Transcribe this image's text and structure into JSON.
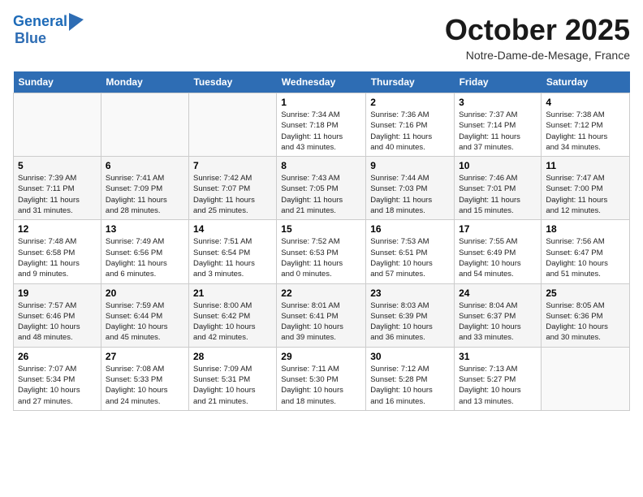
{
  "header": {
    "logo_line1": "General",
    "logo_line2": "Blue",
    "month": "October 2025",
    "location": "Notre-Dame-de-Mesage, France"
  },
  "days_of_week": [
    "Sunday",
    "Monday",
    "Tuesday",
    "Wednesday",
    "Thursday",
    "Friday",
    "Saturday"
  ],
  "weeks": [
    [
      {
        "day": "",
        "info": ""
      },
      {
        "day": "",
        "info": ""
      },
      {
        "day": "",
        "info": ""
      },
      {
        "day": "1",
        "info": "Sunrise: 7:34 AM\nSunset: 7:18 PM\nDaylight: 11 hours\nand 43 minutes."
      },
      {
        "day": "2",
        "info": "Sunrise: 7:36 AM\nSunset: 7:16 PM\nDaylight: 11 hours\nand 40 minutes."
      },
      {
        "day": "3",
        "info": "Sunrise: 7:37 AM\nSunset: 7:14 PM\nDaylight: 11 hours\nand 37 minutes."
      },
      {
        "day": "4",
        "info": "Sunrise: 7:38 AM\nSunset: 7:12 PM\nDaylight: 11 hours\nand 34 minutes."
      }
    ],
    [
      {
        "day": "5",
        "info": "Sunrise: 7:39 AM\nSunset: 7:11 PM\nDaylight: 11 hours\nand 31 minutes."
      },
      {
        "day": "6",
        "info": "Sunrise: 7:41 AM\nSunset: 7:09 PM\nDaylight: 11 hours\nand 28 minutes."
      },
      {
        "day": "7",
        "info": "Sunrise: 7:42 AM\nSunset: 7:07 PM\nDaylight: 11 hours\nand 25 minutes."
      },
      {
        "day": "8",
        "info": "Sunrise: 7:43 AM\nSunset: 7:05 PM\nDaylight: 11 hours\nand 21 minutes."
      },
      {
        "day": "9",
        "info": "Sunrise: 7:44 AM\nSunset: 7:03 PM\nDaylight: 11 hours\nand 18 minutes."
      },
      {
        "day": "10",
        "info": "Sunrise: 7:46 AM\nSunset: 7:01 PM\nDaylight: 11 hours\nand 15 minutes."
      },
      {
        "day": "11",
        "info": "Sunrise: 7:47 AM\nSunset: 7:00 PM\nDaylight: 11 hours\nand 12 minutes."
      }
    ],
    [
      {
        "day": "12",
        "info": "Sunrise: 7:48 AM\nSunset: 6:58 PM\nDaylight: 11 hours\nand 9 minutes."
      },
      {
        "day": "13",
        "info": "Sunrise: 7:49 AM\nSunset: 6:56 PM\nDaylight: 11 hours\nand 6 minutes."
      },
      {
        "day": "14",
        "info": "Sunrise: 7:51 AM\nSunset: 6:54 PM\nDaylight: 11 hours\nand 3 minutes."
      },
      {
        "day": "15",
        "info": "Sunrise: 7:52 AM\nSunset: 6:53 PM\nDaylight: 11 hours\nand 0 minutes."
      },
      {
        "day": "16",
        "info": "Sunrise: 7:53 AM\nSunset: 6:51 PM\nDaylight: 10 hours\nand 57 minutes."
      },
      {
        "day": "17",
        "info": "Sunrise: 7:55 AM\nSunset: 6:49 PM\nDaylight: 10 hours\nand 54 minutes."
      },
      {
        "day": "18",
        "info": "Sunrise: 7:56 AM\nSunset: 6:47 PM\nDaylight: 10 hours\nand 51 minutes."
      }
    ],
    [
      {
        "day": "19",
        "info": "Sunrise: 7:57 AM\nSunset: 6:46 PM\nDaylight: 10 hours\nand 48 minutes."
      },
      {
        "day": "20",
        "info": "Sunrise: 7:59 AM\nSunset: 6:44 PM\nDaylight: 10 hours\nand 45 minutes."
      },
      {
        "day": "21",
        "info": "Sunrise: 8:00 AM\nSunset: 6:42 PM\nDaylight: 10 hours\nand 42 minutes."
      },
      {
        "day": "22",
        "info": "Sunrise: 8:01 AM\nSunset: 6:41 PM\nDaylight: 10 hours\nand 39 minutes."
      },
      {
        "day": "23",
        "info": "Sunrise: 8:03 AM\nSunset: 6:39 PM\nDaylight: 10 hours\nand 36 minutes."
      },
      {
        "day": "24",
        "info": "Sunrise: 8:04 AM\nSunset: 6:37 PM\nDaylight: 10 hours\nand 33 minutes."
      },
      {
        "day": "25",
        "info": "Sunrise: 8:05 AM\nSunset: 6:36 PM\nDaylight: 10 hours\nand 30 minutes."
      }
    ],
    [
      {
        "day": "26",
        "info": "Sunrise: 7:07 AM\nSunset: 5:34 PM\nDaylight: 10 hours\nand 27 minutes."
      },
      {
        "day": "27",
        "info": "Sunrise: 7:08 AM\nSunset: 5:33 PM\nDaylight: 10 hours\nand 24 minutes."
      },
      {
        "day": "28",
        "info": "Sunrise: 7:09 AM\nSunset: 5:31 PM\nDaylight: 10 hours\nand 21 minutes."
      },
      {
        "day": "29",
        "info": "Sunrise: 7:11 AM\nSunset: 5:30 PM\nDaylight: 10 hours\nand 18 minutes."
      },
      {
        "day": "30",
        "info": "Sunrise: 7:12 AM\nSunset: 5:28 PM\nDaylight: 10 hours\nand 16 minutes."
      },
      {
        "day": "31",
        "info": "Sunrise: 7:13 AM\nSunset: 5:27 PM\nDaylight: 10 hours\nand 13 minutes."
      },
      {
        "day": "",
        "info": ""
      }
    ]
  ]
}
